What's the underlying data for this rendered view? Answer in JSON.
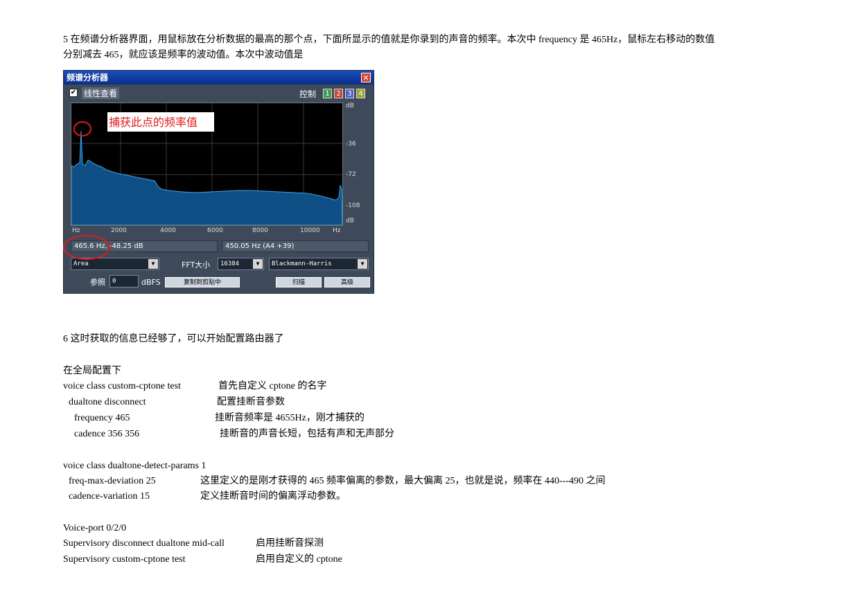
{
  "para5": {
    "line1": "5  在频谱分析器界面，用鼠标放在分析数据的最高的那个点，下面所显示的值就是你录到的声音的频率。本次中 frequency 是 465Hz，鼠标左右移动的数值",
    "line2": "分别减去  465，就应该是频率的波动值。本次中波动值是"
  },
  "analyzer": {
    "title": "频谱分析器",
    "close": "✕",
    "linear_view_label": "线性查看",
    "control_label": "控制",
    "control_buttons": [
      "1",
      "2",
      "3",
      "4"
    ],
    "annotation": "捕获此点的频率值",
    "db_top": "dB",
    "db_ticks": [
      "-36",
      "-72",
      "-108"
    ],
    "db_bottom": "dB",
    "x_ticks": [
      "Hz",
      "2000",
      "4000",
      "6000",
      "8000",
      "10000",
      "Hz"
    ],
    "readout_left": "465.6 Hz, -48.25 dB",
    "readout_right": "450.05 Hz (A4 +39)",
    "display_mode": "Area",
    "fft_label": "FFT大小",
    "fft_size": "16384",
    "window": "Blackmann-Harris",
    "ref_label": "参照",
    "ref_value": "0",
    "dbfs_label": "dBFS",
    "copy_button": "复制到剪贴中",
    "scan_button": "扫描",
    "advanced_button": "高级"
  },
  "para6": "6  这时获取的信息已经够了，可以开始配置路由器了",
  "config": {
    "heading": "在全局配置下",
    "rows1": [
      {
        "cmd": "voice class custom-cptone test",
        "desc": "首先自定义  cptone 的名字"
      },
      {
        "cmd": "dualtone disconnect",
        "desc": "配置挂断音参数"
      },
      {
        "cmd": "frequency 465",
        "desc": "挂断音频率是 4655Hz，刚才捕获的"
      },
      {
        "cmd": "cadence 356 356",
        "desc": "挂断音的声音长短，包括有声和无声部分"
      }
    ],
    "rows2": [
      {
        "cmd": "voice class dualtone-detect-params 1",
        "desc": ""
      },
      {
        "cmd": "freq-max-deviation 25",
        "desc": "这里定义的是刚才获得的 465 频率偏离的参数，最大偏离 25，也就是说，频率在 440---490 之间"
      },
      {
        "cmd": "cadence-variation 15",
        "desc": "定义挂断音时间的偏离浮动参数。"
      }
    ],
    "rows3": [
      {
        "cmd": "Voice-port 0/2/0",
        "desc": ""
      },
      {
        "cmd": "Supervisory disconnect dualtone mid-call",
        "desc": "启用挂断音探测"
      },
      {
        "cmd": "Supervisory custom-cptone test",
        "desc": "启用自定义的 cptone"
      }
    ]
  }
}
